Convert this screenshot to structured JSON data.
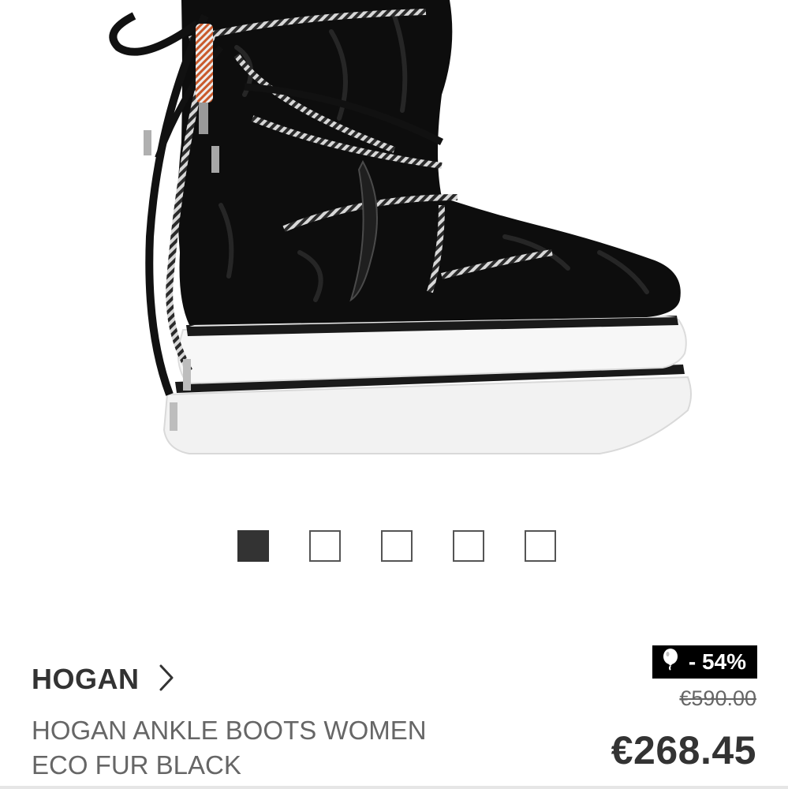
{
  "product": {
    "brand": "HOGAN",
    "title": "HOGAN ANKLE BOOTS WOMEN ECO FUR BLACK",
    "discount": "- 54%",
    "old_price": "€590.00",
    "current_price": "€268.45",
    "image_icon": "boot-product-image"
  },
  "carousel": {
    "total": 5,
    "active_index": 0
  },
  "icons": {
    "brand_link": "chevron-right-icon",
    "badge": "balloon-icon"
  },
  "colors": {
    "text_dark": "#333333",
    "text_muted": "#666666",
    "badge_bg": "#000000"
  }
}
